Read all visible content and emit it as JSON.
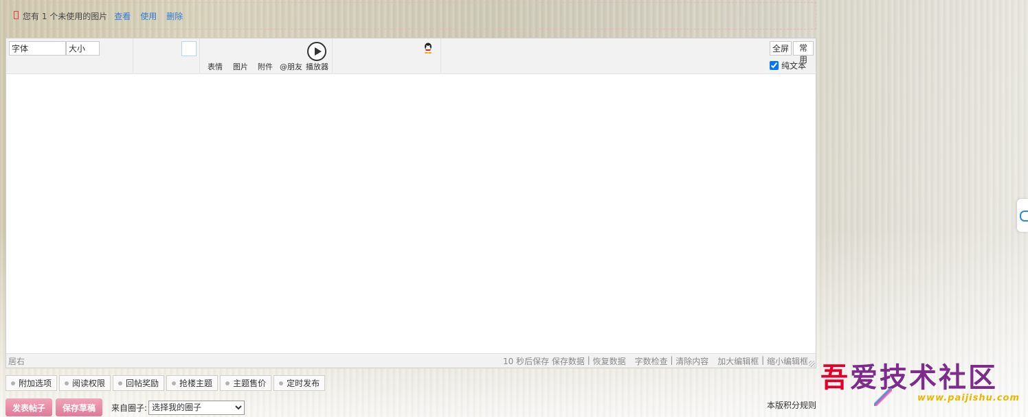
{
  "notice": {
    "message": "您有 1 个未使用的图片",
    "view_link": "查看",
    "use_link": "使用",
    "delete_link": "删除"
  },
  "toolbar": {
    "font_value": "字体",
    "size_value": "大小",
    "labels": [
      "表情",
      "图片",
      "附件",
      "@朋友",
      "播放器"
    ],
    "fullscreen_button": "全屏",
    "common_button": "常用",
    "plain_text_label": "纯文本",
    "plain_text_checked": true
  },
  "statusbar": {
    "align": "居右",
    "autosave": "10 秒后保存 ",
    "save_data": "保存数据",
    "sep": " | ",
    "restore_data": "恢复数据",
    "word_check": "字数检查",
    "clear_content": "清除内容",
    "enlarge": "加大编辑框",
    "shrink": "缩小编辑框"
  },
  "options": [
    "附加选项",
    "阅读权限",
    "回帖奖励",
    "抢楼主题",
    "主题售价",
    "定时发布"
  ],
  "submit": {
    "post_button": "发表帖子",
    "draft_button": "保存草稿",
    "from_label": "来自圈子:",
    "circle_selected": "选择我的圈子",
    "rules_link": "本版积分规则"
  },
  "logo": {
    "text": "吾爱技术社区",
    "url": "www.paijishu.com"
  }
}
